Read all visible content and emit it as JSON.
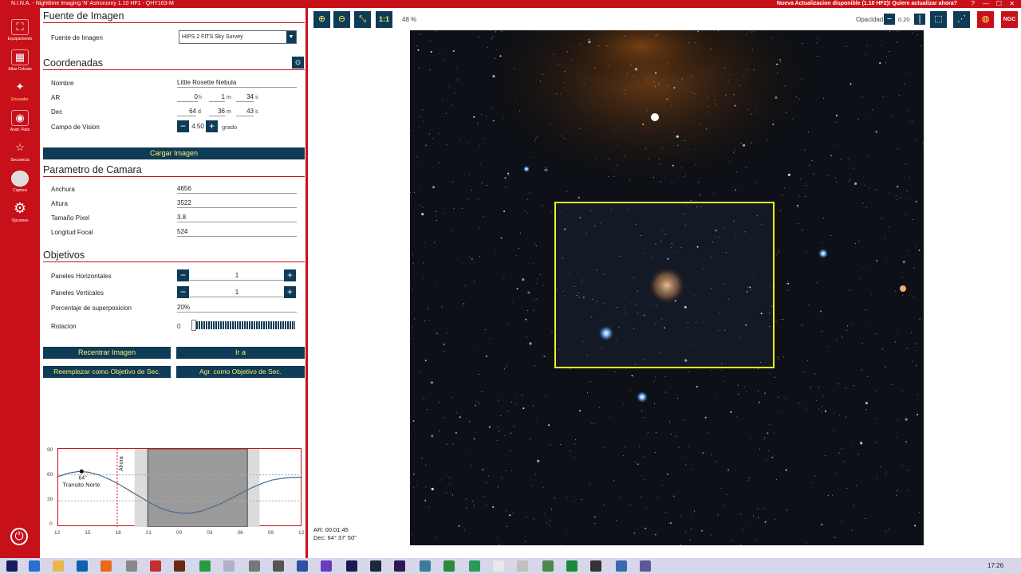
{
  "window": {
    "title": "N.I.N.A. - Nighttime Imaging 'N' Astronomy 1.10 HF1  -  QHY163-M",
    "update_notice": "Nueva Actualizacion disponible (1.10 HF2)! Quiere actualizar ahora?",
    "controls": [
      "?",
      "—",
      "☐",
      "✕"
    ]
  },
  "sidebar": {
    "items": [
      {
        "label": "Equipamiento",
        "icon": "camera-icon"
      },
      {
        "label": "Atlas Celeste",
        "icon": "atlas-icon"
      },
      {
        "label": "Encuadre",
        "icon": "framing-icon"
      },
      {
        "label": "Asist. Flats",
        "icon": "flats-icon"
      },
      {
        "label": "Secuencia",
        "icon": "sequence-icon"
      },
      {
        "label": "Captura",
        "icon": "capture-icon"
      },
      {
        "label": "Opciones",
        "icon": "gear-icon"
      }
    ]
  },
  "image_source": {
    "header": "Fuente de Imagen",
    "label": "Fuente de Imagen",
    "value": "HIPS 2 FITS Sky Survey"
  },
  "coordinates": {
    "header": "Coordenadas",
    "name_label": "Nombre",
    "name": "Little Rosette Nebula",
    "ra_label": "AR",
    "ra_h": "0",
    "ra_h_unit": "h",
    "ra_m": "1",
    "ra_m_unit": "m",
    "ra_s": "34",
    "ra_s_unit": "s",
    "dec_label": "Dec",
    "dec_d": "64",
    "dec_d_unit": "d",
    "dec_m": "36",
    "dec_m_unit": "m",
    "dec_s": "43",
    "dec_s_unit": "s",
    "fov_label": "Campo de Vision",
    "fov": "4.50",
    "fov_unit": "grado",
    "load_button": "Cargar Imagen"
  },
  "camera": {
    "header": "Parametro de Camara",
    "width_label": "Anchura",
    "width": "4656",
    "height_label": "Altura",
    "height": "3522",
    "pixel_label": "Tamaño Pixel",
    "pixel": "3.8",
    "focal_label": "Longitud Focal",
    "focal": "524"
  },
  "targets": {
    "header": "Objetivos",
    "hpanels_label": "Paneles Horizontales",
    "hpanels": "1",
    "vpanels_label": "Paneles Verticales",
    "vpanels": "1",
    "overlap_label": "Porcentaje de superposicion",
    "overlap": "20%",
    "rotation_label": "Rotacion",
    "rotation": "0",
    "recenter_button": "Recentrar Imagen",
    "goto_button": "Ir a",
    "replace_button": "Reemplazar como Objetivo de Sec.",
    "add_button": "Agr. como Objetivo de Sec."
  },
  "toolbar": {
    "zoom": "48 %",
    "one_to_one": "1:1",
    "opacity_label": "Opacidad",
    "opacity": "0.20",
    "ngc": "NGC"
  },
  "sky": {
    "ar_readout": "AR: 00:01:45",
    "dec_readout": "Dec: 64° 37' 50\""
  },
  "taskbar": {
    "time": "17:26"
  },
  "chart_data": {
    "type": "line",
    "ylim": [
      0,
      90
    ],
    "yticks": [
      "90",
      "60",
      "30",
      "0"
    ],
    "xticks": [
      "12",
      "15",
      "18",
      "21",
      "00",
      "03",
      "06",
      "09",
      "12"
    ],
    "x": [
      12,
      13,
      14,
      15,
      16,
      17,
      18,
      19,
      20,
      21,
      22,
      23,
      24,
      25,
      26,
      27,
      28,
      29,
      30,
      31,
      32,
      33,
      34,
      35,
      36
    ],
    "values": [
      58,
      62,
      64,
      63,
      60,
      55,
      49,
      42,
      35,
      28,
      22,
      18,
      16,
      16,
      18,
      22,
      27,
      33,
      39,
      45,
      50,
      54,
      56,
      57,
      57
    ],
    "now_label": "Ahora",
    "transit_label": "64°",
    "transit_text": "Transito Norte",
    "transit_x": 14.3,
    "transit_y": 64
  }
}
